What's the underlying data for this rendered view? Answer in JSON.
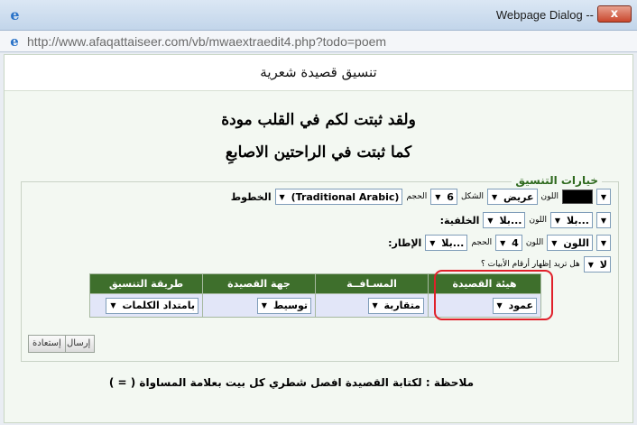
{
  "window": {
    "title": "Webpage Dialog --",
    "close": "x",
    "url": "http://www.afaqattaiseer.com/vb/mwaextraedit4.php?todo=poem"
  },
  "page": {
    "heading": "تنسيق قصيدة شعرية",
    "verse1": "ولقد ثبتت لكم في القلب مودة",
    "verse2": "كما ثبتت في الراحتين الاصابعِ"
  },
  "options": {
    "legend": "خيارات التنسيق",
    "font": {
      "label": "الخطوط",
      "value": "(Traditional Arabic)",
      "size_label": "الحجم",
      "size": "6",
      "shape_label": "الشكل",
      "shape": "عريض",
      "color_label": "اللون"
    },
    "background": {
      "label": "الخلفية:",
      "value": "بلا...",
      "color_label": "اللون",
      "color": "بلا..."
    },
    "border": {
      "label": "الإطار:",
      "value": "بلا...",
      "size_label": "الحجم",
      "size": "4",
      "color_label": "اللون",
      "color": "اللون"
    },
    "numbers": {
      "label": "هل تريد إظهار أرقام الأبيات ؟",
      "value": "لا"
    },
    "columns": [
      "هيئة القصيدة",
      "المسـافــة",
      "جهة القصيدة",
      "طريقة التنسيق"
    ],
    "values": [
      "عمود",
      "متقاربة",
      "توسيط",
      "بامتداد الكلمات"
    ],
    "accent": "#3e6f2c",
    "highlight": "#e0202a"
  },
  "buttons": {
    "submit": "إرسال",
    "reset": "إستعادة"
  },
  "note": "ملاحظة : لكتابة القصيدة افصل شطري كل بيت بعلامة المساواة ( = )"
}
